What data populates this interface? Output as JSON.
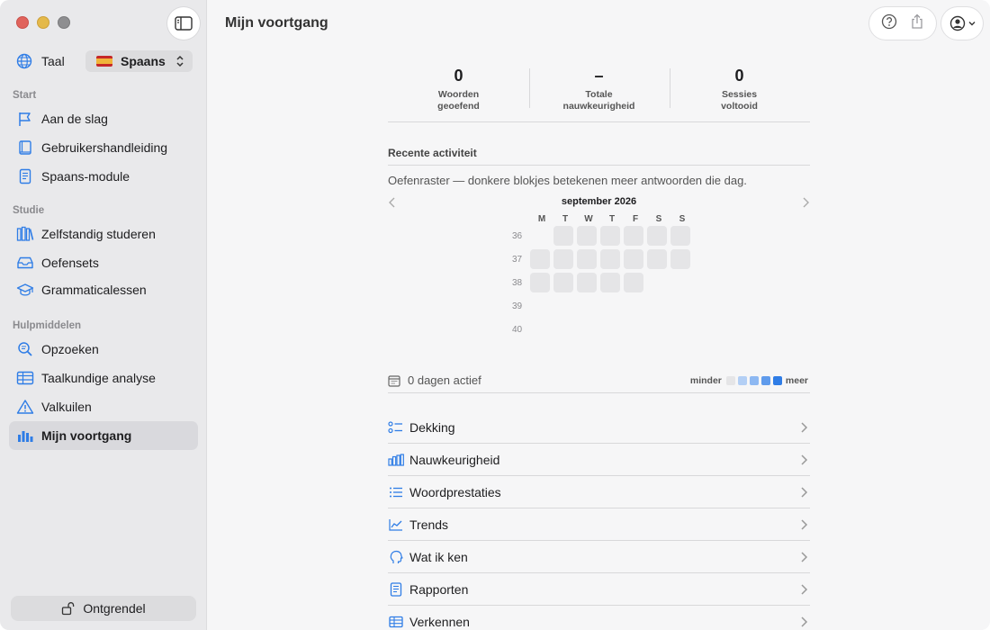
{
  "sidebar": {
    "language_label": "Taal",
    "language_value": "Spaans",
    "sections": {
      "start": "Start",
      "studie": "Studie",
      "hulpmiddelen": "Hulpmiddelen"
    },
    "items": [
      {
        "label": "Aan de slag",
        "icon": "flag-icon"
      },
      {
        "label": "Gebruikershandleiding",
        "icon": "book-icon"
      },
      {
        "label": "Spaans-module",
        "icon": "document-icon"
      },
      {
        "label": "Zelfstandig studeren",
        "icon": "books-icon"
      },
      {
        "label": "Oefensets",
        "icon": "tray-icon"
      },
      {
        "label": "Grammaticalessen",
        "icon": "graduation-cap-icon"
      },
      {
        "label": "Opzoeken",
        "icon": "magnifier-icon"
      },
      {
        "label": "Taalkundige analyse",
        "icon": "table-icon"
      },
      {
        "label": "Valkuilen",
        "icon": "warning-icon"
      },
      {
        "label": "Mijn voortgang",
        "icon": "chart-bars-icon",
        "active": true
      }
    ],
    "unlock_label": "Ontgrendel"
  },
  "header": {
    "title": "Mijn voortgang"
  },
  "stats": [
    {
      "value": "0",
      "caption_line1": "Woorden",
      "caption_line2": "geoefend"
    },
    {
      "value": "–",
      "caption_line1": "Totale",
      "caption_line2": "nauwkeurigheid"
    },
    {
      "value": "0",
      "caption_line1": "Sessies",
      "caption_line2": "voltooid"
    }
  ],
  "activity": {
    "heading": "Recente activiteit",
    "description": "Oefenraster — donkere blokjes betekenen meer antwoorden die dag.",
    "month": "september 2026",
    "weekdays": [
      "M",
      "T",
      "W",
      "T",
      "F",
      "S",
      "S"
    ],
    "weeks": [
      {
        "number": "36",
        "cells": [
          0,
          1,
          1,
          1,
          1,
          1,
          1
        ]
      },
      {
        "number": "37",
        "cells": [
          1,
          1,
          1,
          1,
          1,
          1,
          1
        ]
      },
      {
        "number": "38",
        "cells": [
          1,
          1,
          1,
          1,
          1,
          0,
          0
        ]
      },
      {
        "number": "39",
        "cells": [
          0,
          0,
          0,
          0,
          0,
          0,
          0
        ]
      },
      {
        "number": "40",
        "cells": [
          0,
          0,
          0,
          0,
          0,
          0,
          0
        ]
      }
    ],
    "active_days": "0 dagen actief",
    "legend_less": "minder",
    "legend_more": "meer",
    "legend_colors": [
      "#e5e5e7",
      "#b3cff5",
      "#8db8f2",
      "#5f9bec",
      "#2f7de6"
    ]
  },
  "menu": [
    {
      "label": "Dekking",
      "icon": "checklist-icon"
    },
    {
      "label": "Nauwkeurigheid",
      "icon": "bar-chart-icon"
    },
    {
      "label": "Woordprestaties",
      "icon": "list-icon"
    },
    {
      "label": "Trends",
      "icon": "line-chart-icon"
    },
    {
      "label": "Wat ik ken",
      "icon": "head-icon"
    },
    {
      "label": "Rapporten",
      "icon": "report-icon"
    },
    {
      "label": "Verkennen",
      "icon": "table-icon"
    }
  ],
  "colors": {
    "accent": "#2f7de6"
  }
}
